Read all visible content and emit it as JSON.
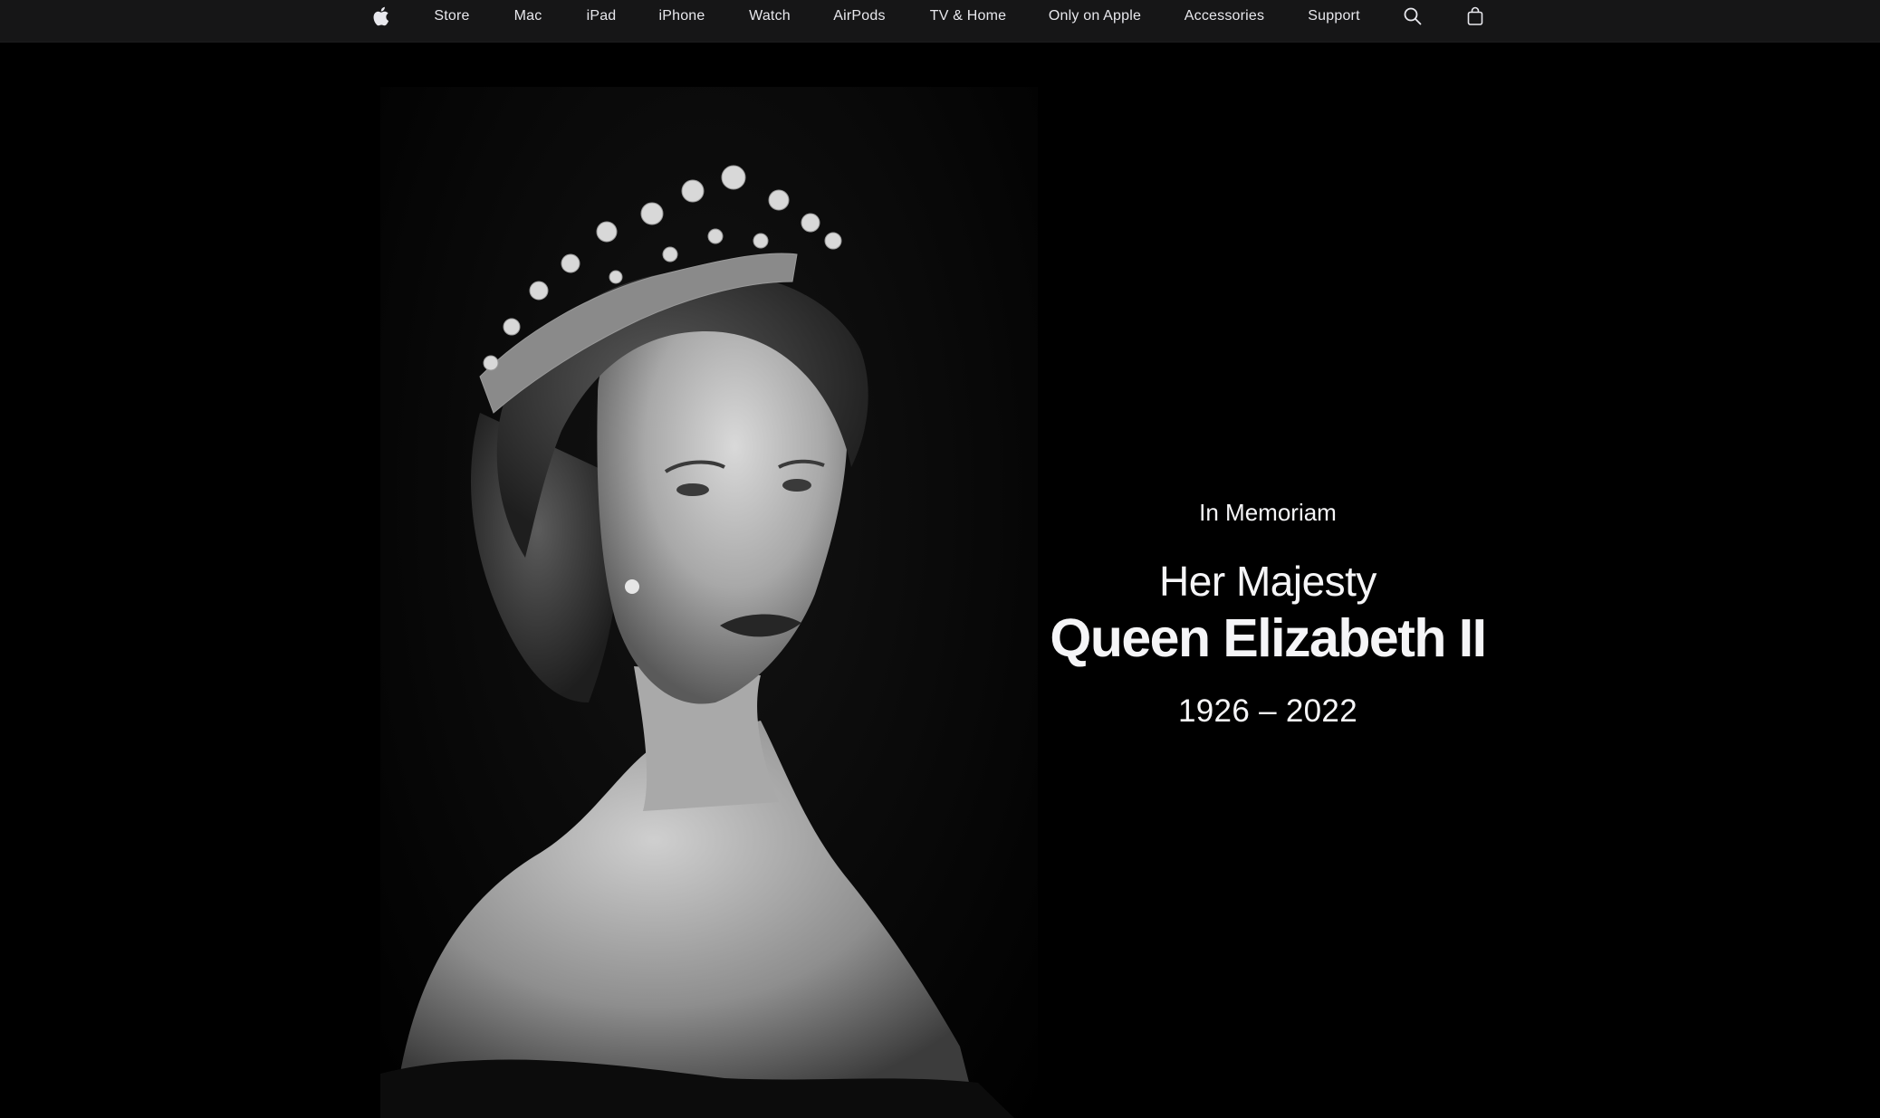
{
  "nav": {
    "logo_icon": "apple-logo-icon",
    "items": [
      {
        "label": "Store"
      },
      {
        "label": "Mac"
      },
      {
        "label": "iPad"
      },
      {
        "label": "iPhone"
      },
      {
        "label": "Watch"
      },
      {
        "label": "AirPods"
      },
      {
        "label": "TV & Home"
      },
      {
        "label": "Only on Apple"
      },
      {
        "label": "Accessories"
      },
      {
        "label": "Support"
      }
    ],
    "search_icon": "search-icon",
    "bag_icon": "shopping-bag-icon"
  },
  "hero": {
    "eyebrow": "In Memoriam",
    "title_line1": "Her Majesty",
    "title_line2": "Queen Elizabeth II",
    "dates": "1926 – 2022"
  },
  "colors": {
    "nav_background": "#161617",
    "nav_text": "#e8e8ed",
    "page_background": "#000000",
    "hero_text": "#f5f5f7"
  }
}
